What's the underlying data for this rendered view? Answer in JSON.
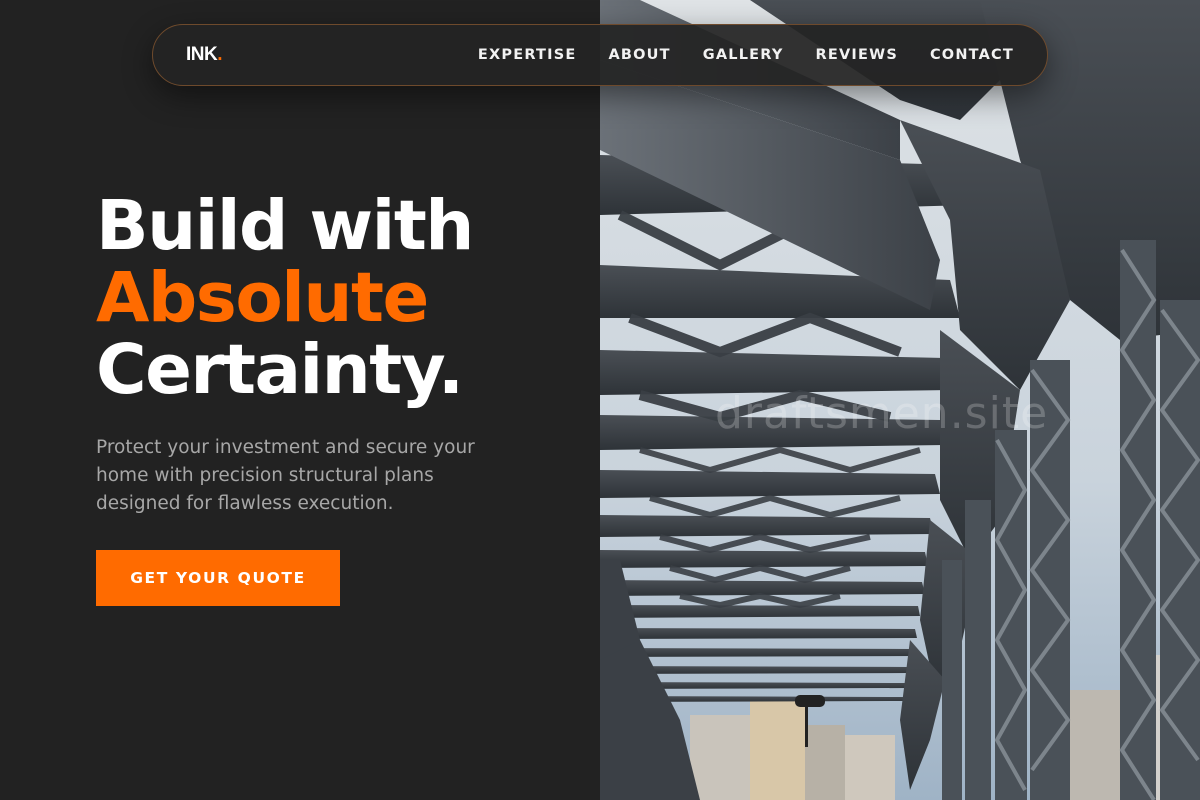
{
  "nav": {
    "logo_text": "INK",
    "logo_dot": ".",
    "links": [
      {
        "label": "EXPERTISE"
      },
      {
        "label": "ABOUT"
      },
      {
        "label": "GALLERY"
      },
      {
        "label": "REVIEWS"
      },
      {
        "label": "CONTACT"
      }
    ]
  },
  "hero": {
    "headline_line1": "Build with",
    "headline_line2": "Absolute",
    "headline_line3": "Certainty.",
    "subtext": "Protect your investment and secure your home with precision structural plans designed for flawless execution.",
    "cta_label": "GET YOUR QUOTE",
    "image_watermark": "draftsmen.site"
  },
  "colors": {
    "background": "#222222",
    "accent": "#ff6b00",
    "muted_text": "#a7a7a7"
  },
  "icons": {
    "hero_image": "steel-truss-bridge-photo"
  }
}
